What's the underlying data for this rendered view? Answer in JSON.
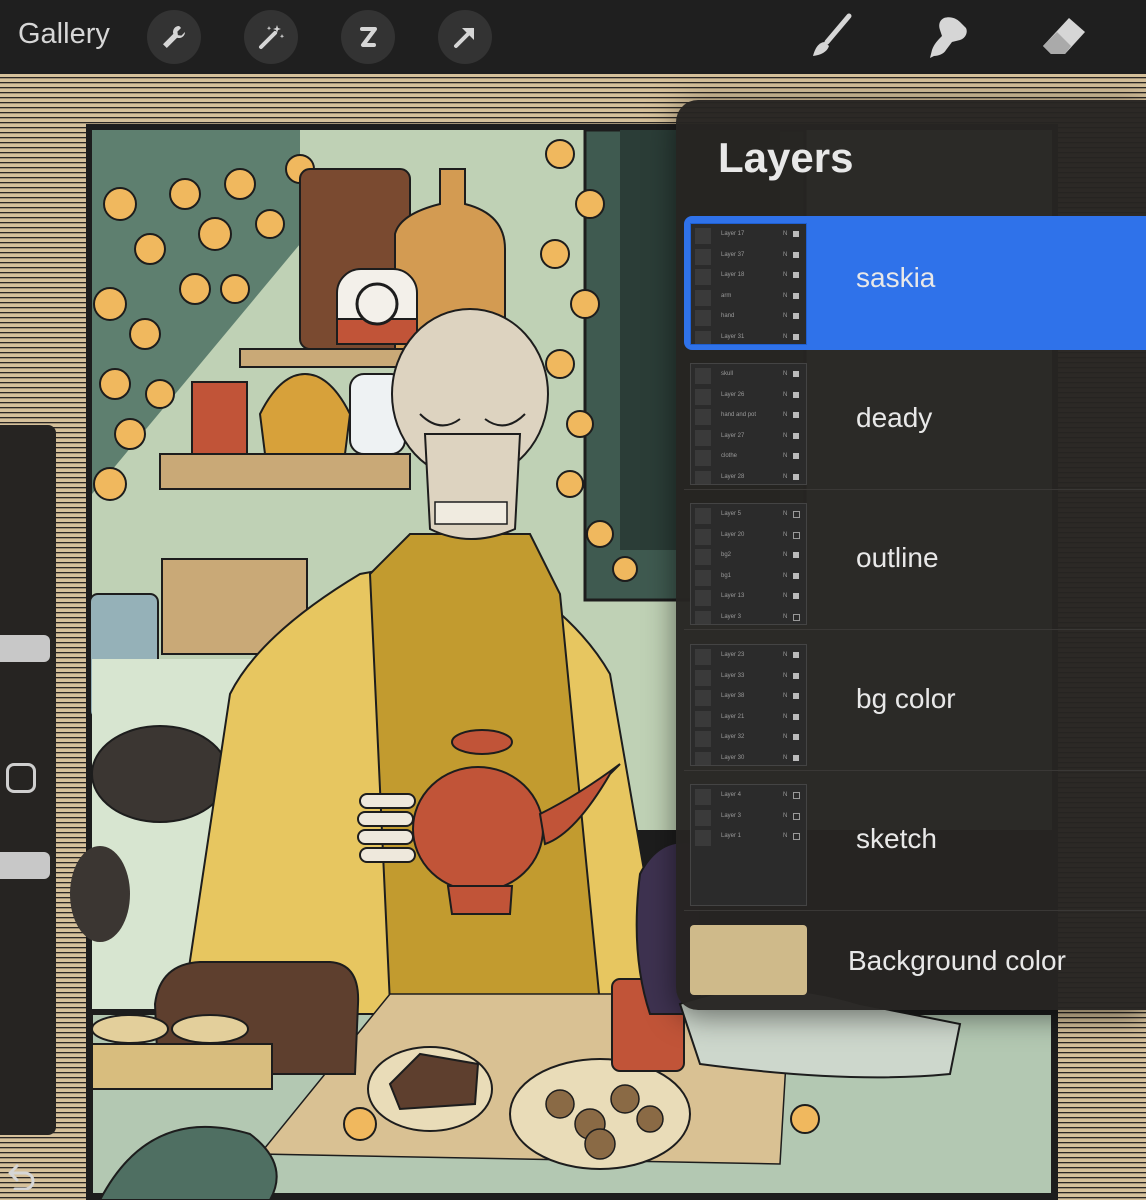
{
  "topbar": {
    "gallery_label": "Gallery",
    "left_tools": [
      "wrench-icon",
      "magic-wand-icon",
      "selection-icon",
      "transform-arrow-icon"
    ],
    "right_tools": [
      "brush-icon",
      "smudge-icon",
      "eraser-icon"
    ]
  },
  "sidebar": {
    "controls": [
      "brush-size-slider",
      "modify-button",
      "opacity-slider",
      "undo-icon"
    ]
  },
  "layers": {
    "title": "Layers",
    "groups": [
      {
        "name": "saskia",
        "selected": true,
        "sublayers": [
          {
            "name": "Layer 17",
            "mode": "N",
            "visible": true
          },
          {
            "name": "Layer 37",
            "mode": "N",
            "visible": true
          },
          {
            "name": "Layer 18",
            "mode": "N",
            "visible": true
          },
          {
            "name": "arm",
            "mode": "N",
            "visible": true
          },
          {
            "name": "hand",
            "mode": "N",
            "visible": true
          },
          {
            "name": "Layer 31",
            "mode": "N",
            "visible": true
          }
        ]
      },
      {
        "name": "deady",
        "selected": false,
        "sublayers": [
          {
            "name": "skull",
            "mode": "N",
            "visible": true
          },
          {
            "name": "Layer 26",
            "mode": "N",
            "visible": true
          },
          {
            "name": "hand and pot",
            "mode": "N",
            "visible": true
          },
          {
            "name": "Layer 27",
            "mode": "N",
            "visible": true
          },
          {
            "name": "clothe",
            "mode": "N",
            "visible": true
          },
          {
            "name": "Layer 28",
            "mode": "N",
            "visible": true
          }
        ]
      },
      {
        "name": "outline",
        "selected": false,
        "sublayers": [
          {
            "name": "Layer 5",
            "mode": "N",
            "visible": false
          },
          {
            "name": "Layer 20",
            "mode": "N",
            "visible": false
          },
          {
            "name": "bg2",
            "mode": "N",
            "visible": true
          },
          {
            "name": "bg1",
            "mode": "N",
            "visible": true
          },
          {
            "name": "Layer 13",
            "mode": "N",
            "visible": true
          },
          {
            "name": "Layer 3",
            "mode": "N",
            "visible": false
          }
        ]
      },
      {
        "name": "bg color",
        "selected": false,
        "sublayers": [
          {
            "name": "Layer 23",
            "mode": "N",
            "visible": true
          },
          {
            "name": "Layer 33",
            "mode": "N",
            "visible": true
          },
          {
            "name": "Layer 38",
            "mode": "N",
            "visible": true
          },
          {
            "name": "Layer 21",
            "mode": "N",
            "visible": true
          },
          {
            "name": "Layer 32",
            "mode": "N",
            "visible": true
          },
          {
            "name": "Layer 30",
            "mode": "N",
            "visible": true
          }
        ]
      },
      {
        "name": "sketch",
        "selected": false,
        "sublayers": [
          {
            "name": "Layer 4",
            "mode": "N",
            "visible": false
          },
          {
            "name": "Layer 3",
            "mode": "N",
            "visible": false
          },
          {
            "name": "Layer 1",
            "mode": "N",
            "visible": false
          }
        ]
      }
    ],
    "background": {
      "label": "Background color",
      "color": "#cfba8a"
    }
  },
  "colors": {
    "accent": "#2f72ea",
    "panel": "#262422",
    "topbar": "#1f1f1f"
  }
}
